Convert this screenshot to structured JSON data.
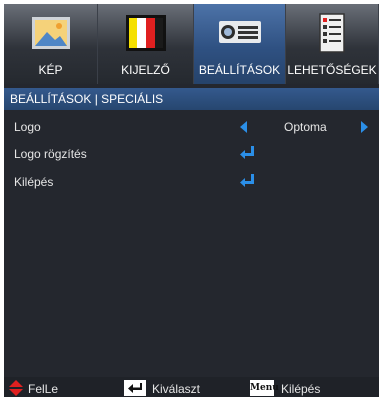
{
  "tabs": [
    {
      "label": "KÉP",
      "icon": "picture-icon",
      "active": false
    },
    {
      "label": "KIJELZŐ",
      "icon": "display-icon",
      "active": false
    },
    {
      "label": "BEÁLLÍTÁSOK",
      "icon": "projector-icon",
      "active": true
    },
    {
      "label": "LEHETŐSÉGEK",
      "icon": "options-icon",
      "active": false
    }
  ],
  "breadcrumb": "BEÁLLÍTÁSOK | SPECIÁLIS",
  "rows": [
    {
      "label": "Logo",
      "value": "Optoma",
      "control": "selector"
    },
    {
      "label": "Logo rögzítés",
      "control": "enter"
    },
    {
      "label": "Kilépés",
      "control": "enter"
    }
  ],
  "footer": {
    "updown_label": "FelLe",
    "select_label": "Kiválaszt",
    "menu_key": "Menu",
    "exit_label": "Kilépés"
  },
  "colors": {
    "accent": "#2b8fe8",
    "active_tab": "#2f5182",
    "background": "#24272e",
    "updown": "#e02020"
  }
}
